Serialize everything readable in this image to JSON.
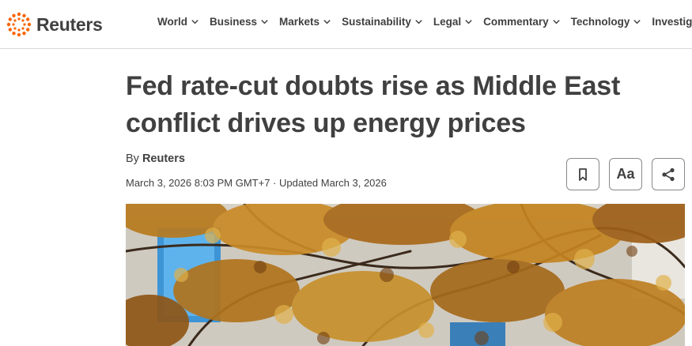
{
  "brand": {
    "name": "Reuters",
    "accent": "#fa6400"
  },
  "nav": {
    "items": [
      {
        "label": "World"
      },
      {
        "label": "Business"
      },
      {
        "label": "Markets"
      },
      {
        "label": "Sustainability"
      },
      {
        "label": "Legal"
      },
      {
        "label": "Commentary"
      },
      {
        "label": "Technology"
      },
      {
        "label": "Investigations"
      }
    ]
  },
  "article": {
    "headline": "Fed rate-cut doubts rise as Middle East conflict drives up energy prices",
    "by_prefix": "By ",
    "author": "Reuters",
    "dateline": "March 3, 2026 8:03 PM GMT+7 · Updated March 3, 2026"
  },
  "tools": {
    "save_icon": "bookmark-icon",
    "text_size_label": "Aa",
    "share_icon": "share-icon"
  }
}
